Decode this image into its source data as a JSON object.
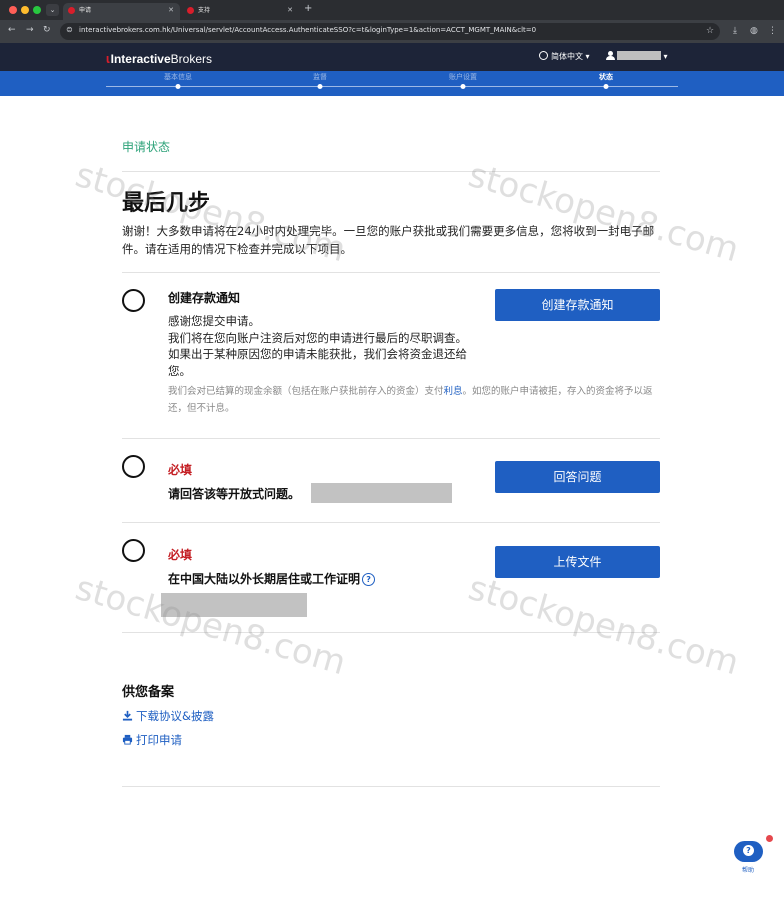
{
  "browser": {
    "tabs": [
      {
        "title": "申请",
        "active": true
      },
      {
        "title": "支持",
        "active": false
      }
    ],
    "url": "interactivebrokers.com.hk/Universal/servlet/AccountAccess.AuthenticateSSO?c=t&loginType=1&action=ACCT_MGMT_MAIN&clt=0",
    "colors": {
      "close": "#ff5f57",
      "minimize": "#febc2e",
      "zoom": "#28c840"
    }
  },
  "header": {
    "logo_interactive": "Interactive",
    "logo_brokers": "Brokers",
    "language": "简体中文",
    "user_name_redacted": true
  },
  "progress_steps": [
    {
      "label": "基本信息",
      "current": false
    },
    {
      "label": "监督",
      "current": false
    },
    {
      "label": "账户设置",
      "current": false
    },
    {
      "label": "状态",
      "current": true
    }
  ],
  "main": {
    "section_title": "申请状态",
    "page_title": "最后几步",
    "intro": "谢谢！大多数申请将在24小时内处理完毕。一旦您的账户获批或我们需要更多信息，您将收到一封电子邮件。请在适用的情况下检查并完成以下项目。",
    "tasks": [
      {
        "title": "创建存款通知",
        "body_1": "感谢您提交申请。",
        "body_2": "我们将在您向账户注资后对您的申请进行最后的尽职调查。如果出于某种原因您的申请未能获批，我们会将资金退还给您。",
        "note_before": "我们会对已结算的现金余额（包括在账户获批前存入的资金）支付",
        "note_link": "利息",
        "note_after": "。如您的账户申请被拒，存入的资金将予以返还，但不计息。",
        "button": "创建存款通知"
      },
      {
        "required_label": "必填",
        "question": "请回答该等开放式问题。",
        "button": "回答问题"
      },
      {
        "required_label": "必填",
        "question": "在中国大陆以外长期居住或工作证明",
        "button": "上传文件"
      }
    ],
    "reference": {
      "title": "供您备案",
      "download_label": "下载协议&披露",
      "print_label": "打印申请"
    }
  },
  "help_widget": {
    "label": "帮助"
  },
  "watermark": "stockopen8.com",
  "colors": {
    "brand_blue": "#1f5fc2",
    "header_navy": "#1d2438",
    "section_green": "#2ea37a",
    "required_red": "#c41f24"
  }
}
